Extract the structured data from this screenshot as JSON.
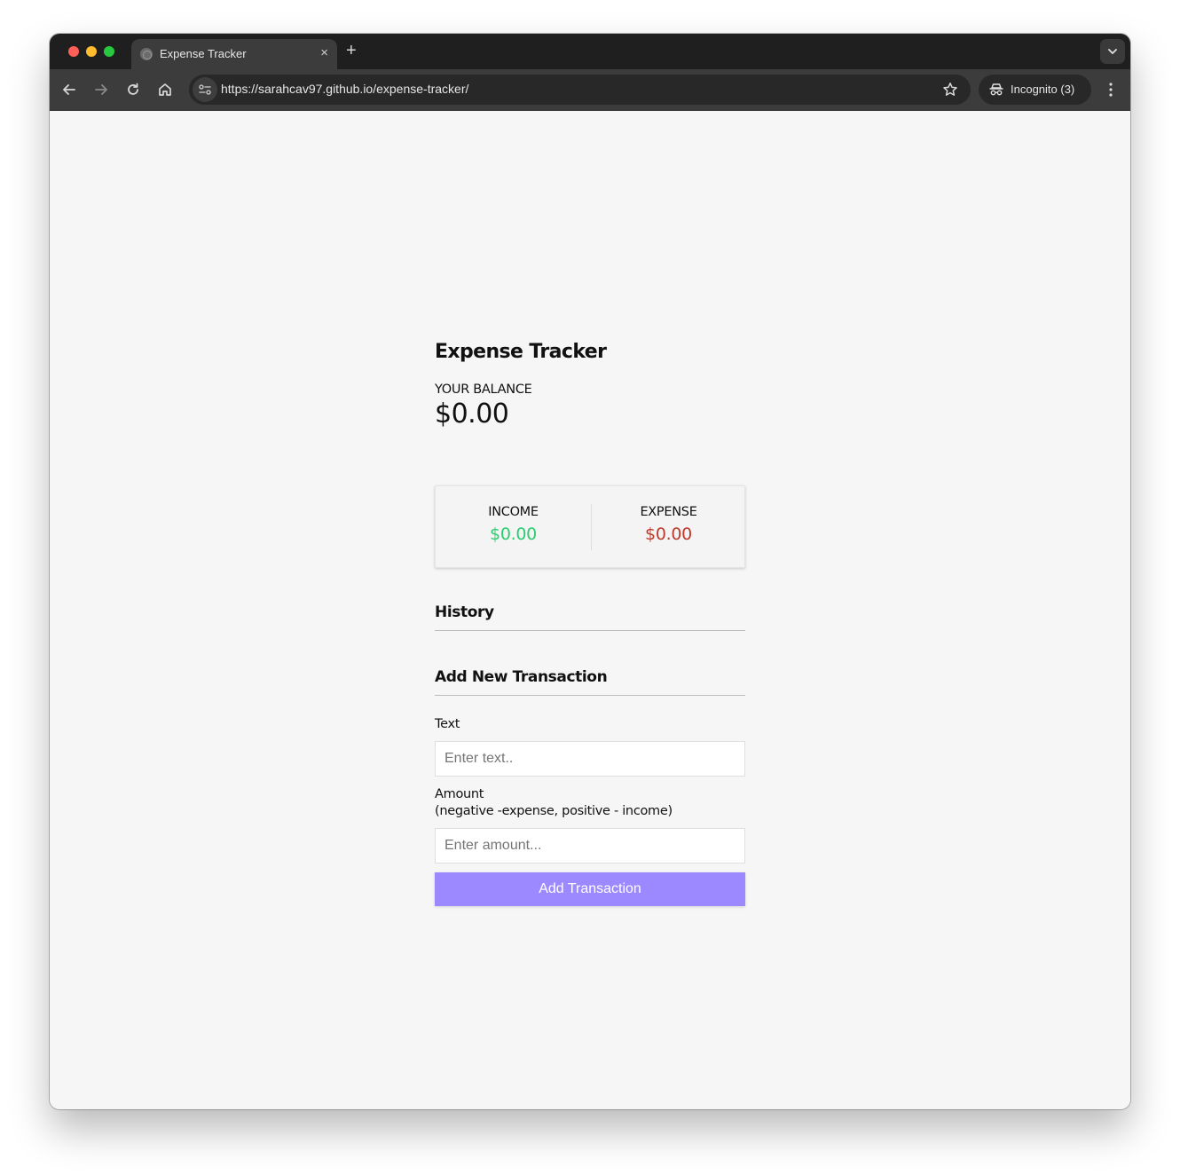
{
  "browser": {
    "tab_title": "Expense Tracker",
    "tab_close_symbol": "×",
    "new_tab_symbol": "+",
    "url": "https://sarahcav97.github.io/expense-tracker/",
    "incognito_label": "Incognito (3)",
    "icons": [
      "back-icon",
      "forward-icon",
      "reload-icon",
      "home-icon",
      "site-info-icon",
      "bookmark-star-icon",
      "incognito-icon",
      "menu-icon",
      "tab-search-icon"
    ]
  },
  "app": {
    "title": "Expense Tracker",
    "balance": {
      "label": "YOUR BALANCE",
      "value": "$0.00"
    },
    "income": {
      "label": "INCOME",
      "value": "$0.00",
      "color": "#2ecc71"
    },
    "expense": {
      "label": "EXPENSE",
      "value": "$0.00",
      "color": "#c0392b"
    },
    "history": {
      "heading": "History",
      "items": []
    },
    "form": {
      "heading": "Add New Transaction",
      "text_label": "Text",
      "text_placeholder": "Enter text..",
      "amount_label_line1": "Amount",
      "amount_label_line2": "(negative -expense, positive - income)",
      "amount_placeholder": "Enter amount...",
      "submit_label": "Add Transaction",
      "submit_color": "#9c88ff"
    }
  }
}
